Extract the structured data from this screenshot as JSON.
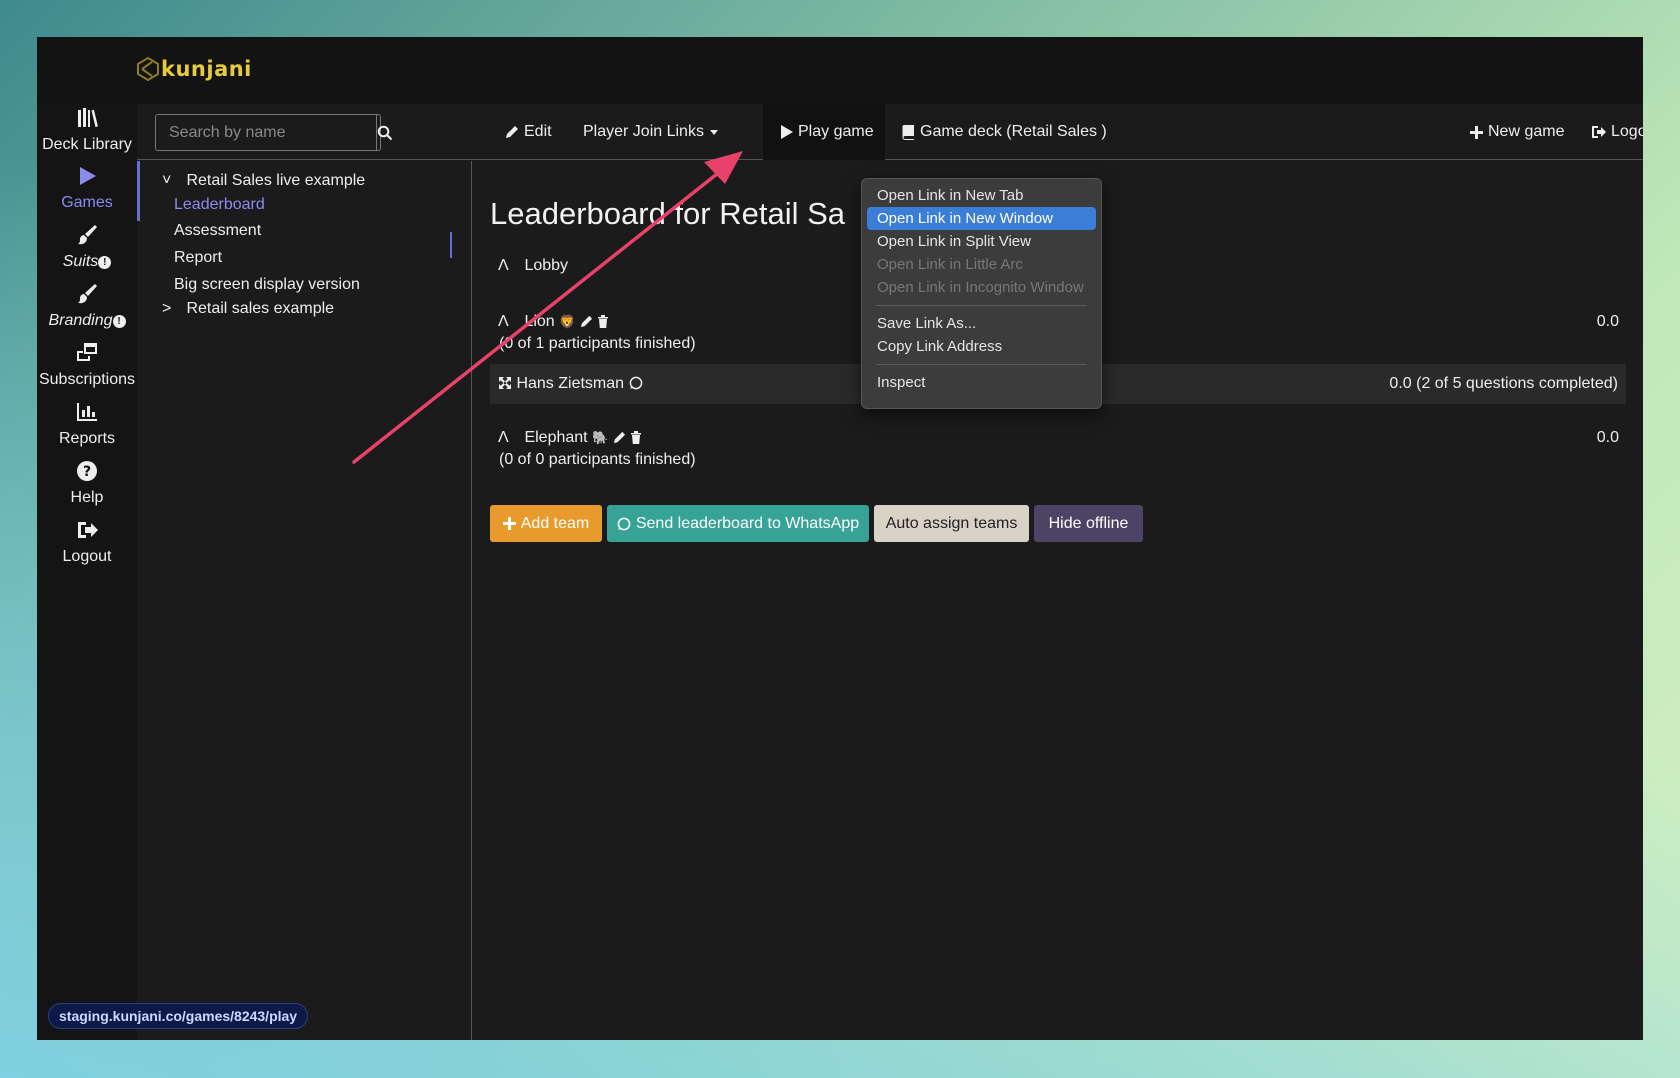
{
  "app": {
    "brand": "kunjani",
    "brand_color": "#e6cc3a",
    "accent": "#8a8cf0"
  },
  "sidebar": {
    "items": [
      {
        "label": "Deck Library",
        "icon": "books-icon",
        "active": false
      },
      {
        "label": "Games",
        "icon": "play-icon",
        "active": true
      },
      {
        "label": "Suits",
        "icon": "paintbrush-icon",
        "badge": "!"
      },
      {
        "label": "Branding",
        "icon": "paintbrush-icon",
        "badge": "!"
      },
      {
        "label": "Subscriptions",
        "icon": "windows-icon"
      },
      {
        "label": "Reports",
        "icon": "bar-chart-icon"
      },
      {
        "label": "Help",
        "icon": "question-circle-icon"
      },
      {
        "label": "Logout",
        "icon": "logout-icon"
      }
    ]
  },
  "search": {
    "placeholder": "Search by name"
  },
  "toolbar": {
    "edit": "Edit",
    "player_join_links": "Player Join Links",
    "play_game": "Play game",
    "game_deck": "Game deck (Retail Sales )",
    "new_game": "New game",
    "logout": "Logout"
  },
  "tree": {
    "root": "Retail Sales live example",
    "children": [
      "Leaderboard",
      "Assessment",
      "Report",
      "Big screen display version"
    ],
    "sibling": "Retail sales example"
  },
  "main": {
    "title": "Leaderboard for Retail Sa",
    "lobby": "Lobby",
    "teams": [
      {
        "name": "Lion",
        "emoji": "🦁",
        "progress": "(0 of 1 participants finished)",
        "score": "0.0",
        "members": [
          {
            "name": "Hans Zietsman",
            "score": "0.0 (2 of 5 questions completed)"
          }
        ]
      },
      {
        "name": "Elephant",
        "emoji": "🐘",
        "progress": "(0 of 0 participants finished)",
        "score": "0.0"
      }
    ],
    "buttons": {
      "add_team": "Add team",
      "send_whatsapp": "Send leaderboard to WhatsApp",
      "auto_assign": "Auto assign teams",
      "hide_offline": "Hide offline"
    }
  },
  "context_menu": {
    "items": [
      {
        "label": "Open Link in New Tab",
        "state": "normal"
      },
      {
        "label": "Open Link in New Window",
        "state": "highlighted"
      },
      {
        "label": "Open Link in Split View",
        "state": "normal"
      },
      {
        "label": "Open Link in Little Arc",
        "state": "disabled"
      },
      {
        "label": "Open Link in Incognito Window",
        "state": "disabled"
      },
      {
        "label": "Save Link As...",
        "state": "normal"
      },
      {
        "label": "Copy Link Address",
        "state": "normal"
      },
      {
        "label": "Inspect",
        "state": "normal"
      }
    ]
  },
  "status_bar": {
    "url": "staging.kunjani.co/games/8243/play"
  },
  "annotation": {
    "arrow_color": "#e8416a"
  }
}
